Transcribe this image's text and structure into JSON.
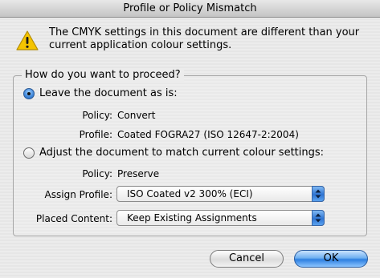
{
  "window": {
    "title": "Profile or Policy Mismatch"
  },
  "message": "The CMYK settings in this document are different than your current application colour settings.",
  "group": {
    "legend": "How do you want to proceed?",
    "option_leave": {
      "label": "Leave the document as is:",
      "selected": true,
      "policy_label": "Policy:",
      "policy_value": "Convert",
      "profile_label": "Profile:",
      "profile_value": "Coated FOGRA27 (ISO 12647-2:2004)"
    },
    "option_adjust": {
      "label": "Adjust the document to match current colour settings:",
      "selected": false,
      "policy_label": "Policy:",
      "policy_value": "Preserve",
      "assign_profile_label": "Assign Profile:",
      "assign_profile_value": "ISO Coated v2 300% (ECI)",
      "placed_content_label": "Placed Content:",
      "placed_content_value": "Keep Existing Assignments"
    }
  },
  "buttons": {
    "cancel": "Cancel",
    "ok": "OK"
  },
  "icons": {
    "warning": "warning-icon",
    "popup_arrows": "up-down-arrows-icon"
  },
  "colors": {
    "accent": "#2d7fe0",
    "warning_yellow": "#f5c400"
  }
}
